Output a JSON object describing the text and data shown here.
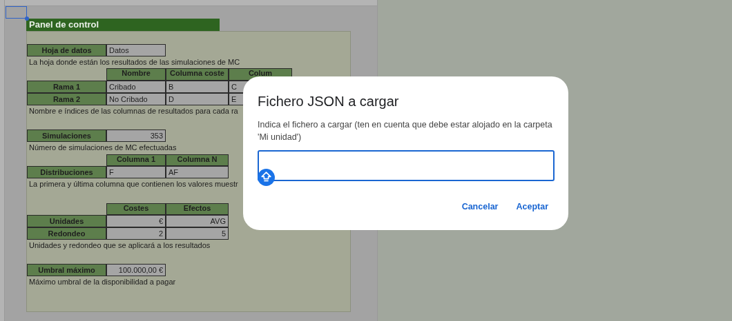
{
  "sheet": {
    "title": "Panel de control",
    "rows": [
      {
        "kind": "blank"
      },
      {
        "kind": "cells",
        "cells": [
          {
            "kind": "label",
            "text": "Hoja de datos"
          },
          {
            "kind": "value",
            "text": "Datos"
          }
        ]
      },
      {
        "kind": "note",
        "text": "La hoja donde están los resultados de las simulaciones de MC"
      },
      {
        "kind": "cells",
        "cells": [
          {
            "kind": "empty"
          },
          {
            "kind": "header",
            "text": "Nombre"
          },
          {
            "kind": "header",
            "text": "Columna coste"
          },
          {
            "kind": "header",
            "text": "Colum"
          }
        ]
      },
      {
        "kind": "cells",
        "cells": [
          {
            "kind": "label",
            "text": "Rama 1"
          },
          {
            "kind": "value",
            "text": "Cribado"
          },
          {
            "kind": "value",
            "text": "B"
          },
          {
            "kind": "value",
            "text": "C"
          }
        ]
      },
      {
        "kind": "cells",
        "cells": [
          {
            "kind": "label",
            "text": "Rama 2"
          },
          {
            "kind": "value",
            "text": "No Cribado"
          },
          {
            "kind": "value",
            "text": "D"
          },
          {
            "kind": "value",
            "text": "E"
          }
        ]
      },
      {
        "kind": "note",
        "text": "Nombre e índices de las columnas de resultados para cada ra"
      },
      {
        "kind": "blank"
      },
      {
        "kind": "cells",
        "cells": [
          {
            "kind": "label",
            "text": "Simulaciones"
          },
          {
            "kind": "number",
            "text": "353"
          }
        ]
      },
      {
        "kind": "note",
        "text": "Número de simulaciones de MC efectuadas"
      },
      {
        "kind": "cells",
        "cells": [
          {
            "kind": "empty"
          },
          {
            "kind": "header",
            "text": "Columna 1"
          },
          {
            "kind": "header",
            "text": "Columna N"
          }
        ]
      },
      {
        "kind": "cells",
        "cells": [
          {
            "kind": "label",
            "text": "Distribuciones"
          },
          {
            "kind": "value",
            "text": "F"
          },
          {
            "kind": "value",
            "text": "AF"
          }
        ]
      },
      {
        "kind": "note",
        "text": "La primera y última columna que contienen los valores muestr"
      },
      {
        "kind": "blank"
      },
      {
        "kind": "cells",
        "cells": [
          {
            "kind": "empty"
          },
          {
            "kind": "header",
            "text": "Costes"
          },
          {
            "kind": "header",
            "text": "Efectos"
          }
        ]
      },
      {
        "kind": "cells",
        "cells": [
          {
            "kind": "label",
            "text": "Unidades"
          },
          {
            "kind": "number",
            "text": "€"
          },
          {
            "kind": "number",
            "text": "AVG"
          }
        ]
      },
      {
        "kind": "cells",
        "cells": [
          {
            "kind": "label",
            "text": "Redondeo"
          },
          {
            "kind": "number",
            "text": "2"
          },
          {
            "kind": "number",
            "text": "5"
          }
        ]
      },
      {
        "kind": "note",
        "text": "Unidades y redondeo que se aplicará a los resultados"
      },
      {
        "kind": "blank"
      },
      {
        "kind": "cells",
        "cells": [
          {
            "kind": "label",
            "text": "Umbral máximo"
          },
          {
            "kind": "number",
            "text": "100.000,00 €"
          }
        ]
      },
      {
        "kind": "note",
        "text": "Máximo umbral de la disponibilidad a pagar"
      }
    ]
  },
  "dialog": {
    "title": "Fichero JSON a cargar",
    "description": "Indica el fichero a cargar (ten en cuenta que debe estar alojado en la carpeta 'Mi unidad')",
    "buttons": [
      "Cancelar",
      "Aceptar"
    ]
  }
}
